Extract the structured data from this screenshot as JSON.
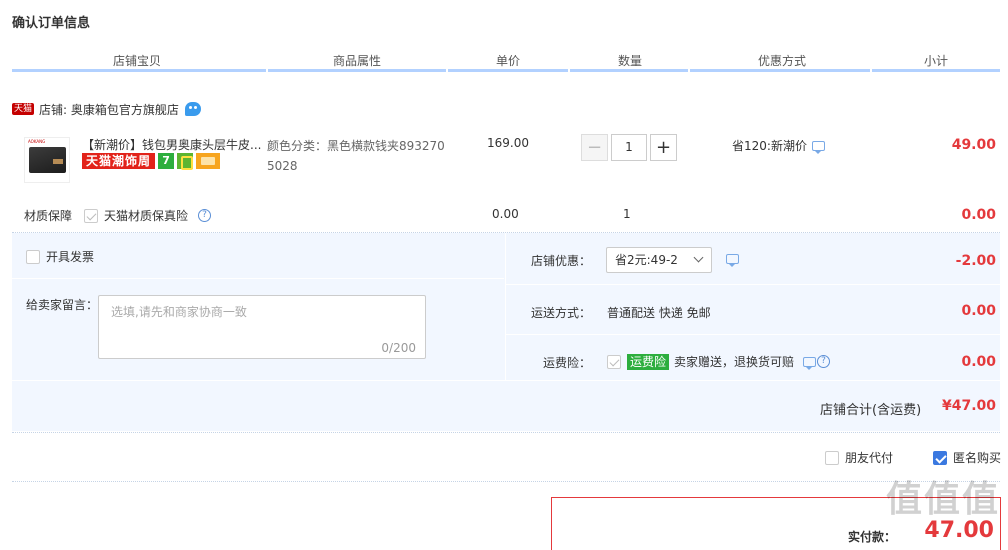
{
  "page_title": "确认订单信息",
  "columns": [
    "店铺宝贝",
    "商品属性",
    "单价",
    "数量",
    "优惠方式",
    "小计"
  ],
  "shop": {
    "badge": "天猫",
    "label": "店铺: 奥康箱包官方旗舰店",
    "brand_on_thumb": "AOKANG"
  },
  "item": {
    "title": "【新潮价】钱包男奥康头层牛皮...",
    "campaign_tag": "天猫潮饰周",
    "seven_day_tag": "7",
    "property": "颜色分类：黑色横款钱夹8932705028",
    "price": "169.00",
    "quantity": "1",
    "promo": "省120:新潮价",
    "subtotal": "49.00"
  },
  "insurance": {
    "label": "材质保障",
    "option": "天猫材质保真险",
    "help": "?",
    "price": "0.00",
    "quantity": "1",
    "subtotal": "0.00"
  },
  "invoice_label": "开具发票",
  "message": {
    "label": "给卖家留言：",
    "placeholder": "选填,请先和商家协商一致",
    "count": "0/200"
  },
  "shop_discount": {
    "label": "店铺优惠：",
    "selected": "省2元:49-2",
    "amount": "-2.00"
  },
  "shipping": {
    "label": "运送方式：",
    "value": "普通配送 快递 免邮",
    "amount": "0.00"
  },
  "shipping_insurance": {
    "label": "运费险：",
    "tag": "运费险",
    "desc": "卖家赠送，退换货可赔",
    "help": "?",
    "amount": "0.00"
  },
  "shop_total": {
    "label": "店铺合计(含运费)",
    "amount": "¥47.00"
  },
  "options": {
    "friend_pay": "朋友代付",
    "anonymous": "匿名购买"
  },
  "payment": {
    "label": "实付款：",
    "amount": "47.00",
    "watermark": "值值值"
  }
}
